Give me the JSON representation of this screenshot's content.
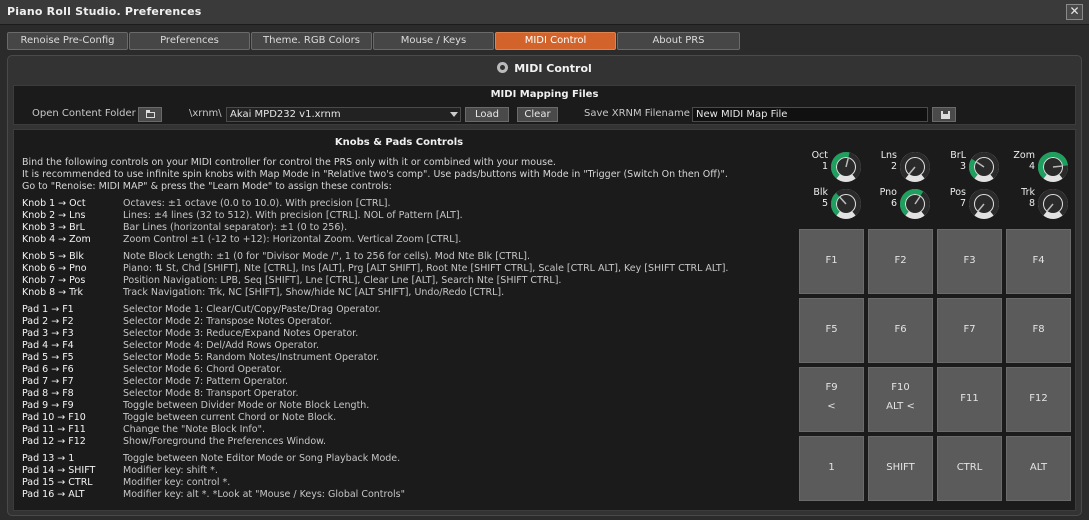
{
  "window": {
    "title": "Piano Roll Studio.  Preferences",
    "close_glyph": "✕"
  },
  "tabs": [
    {
      "label": "Renoise Pre-Config"
    },
    {
      "label": "Preferences"
    },
    {
      "label": "Theme. RGB Colors"
    },
    {
      "label": "Mouse / Keys"
    },
    {
      "label": "MIDI Control",
      "active": true
    },
    {
      "label": "About PRS"
    }
  ],
  "panel": {
    "title": "MIDI Control",
    "icon": "midi-icon"
  },
  "mapping": {
    "title": "MIDI Mapping Files",
    "open_folder_label": "Open Content Folder",
    "path_prefix": "\\xrnm\\",
    "selected_file": "Akai MPD232 v1.xrnm",
    "load_label": "Load",
    "clear_label": "Clear",
    "save_label": "Save XRNM Filename",
    "save_filename": "New MIDI Map File"
  },
  "knobs_pads": {
    "title": "Knobs & Pads Controls",
    "intro": [
      "Bind the following controls on your MIDI controller for control the PRS only with it or combined with your mouse.",
      "It is recommended to use infinite spin knobs with Map Mode in \"Relative two's comp\". Use pads/buttons with Mode in \"Trigger (Switch On then Off)\".",
      "Go to \"Renoise: MIDI MAP\" & press the \"Learn Mode\" to assign these controls:"
    ],
    "knob_rows": [
      {
        "key": "Knob 1 → Oct",
        "desc": "Octaves: ±1 octave (0.0 to 10.0). With precision [CTRL]."
      },
      {
        "key": "Knob 2 → Lns",
        "desc": "Lines: ±4 lines (32 to 512). With precision [CTRL]. NOL of Pattern [ALT]."
      },
      {
        "key": "Knob 3 → BrL",
        "desc": "Bar Lines (horizontal separator): ±1 (0 to 256)."
      },
      {
        "key": "Knob 4 → Zom",
        "desc": "Zoom Control ±1 (-12 to +12): Horizontal Zoom. Vertical Zoom [CTRL]."
      }
    ],
    "knob_rows2": [
      {
        "key": "Knob 5 → Blk",
        "desc": "Note Block Length: ±1 (0 for \"Divisor Mode /\", 1 to 256 for cells). Mod Nte Blk [CTRL]."
      },
      {
        "key": "Knob 6 → Pno",
        "desc": "Piano: ⇅ St, Chd [SHIFT], Nte [CTRL], Ins [ALT], Prg [ALT SHIFT], Root Nte [SHIFT CTRL], Scale [CTRL ALT], Key [SHIFT CTRL ALT]."
      },
      {
        "key": "Knob 7 → Pos",
        "desc": "Position Navigation: LPB, Seq [SHIFT], Lne [CTRL], Clear Lne [ALT], Search Nte [SHIFT CTRL]."
      },
      {
        "key": "Knob 8 → Trk",
        "desc": "Track Navigation: Trk, NC [SHIFT], Show/hide NC [ALT SHIFT], Undo/Redo [CTRL]."
      }
    ],
    "pad_rows": [
      {
        "key": "Pad 1 → F1",
        "desc": "Selector Mode 1: Clear/Cut/Copy/Paste/Drag Operator."
      },
      {
        "key": "Pad 2 → F2",
        "desc": "Selector Mode 2: Transpose Notes Operator."
      },
      {
        "key": "Pad 3 → F3",
        "desc": "Selector Mode 3: Reduce/Expand Notes Operator."
      },
      {
        "key": "Pad 4 → F4",
        "desc": "Selector Mode 4: Del/Add Rows Operator."
      },
      {
        "key": "Pad 5 → F5",
        "desc": "Selector Mode 5: Random Notes/Instrument Operator."
      },
      {
        "key": "Pad 6 → F6",
        "desc": "Selector Mode 6: Chord Operator."
      },
      {
        "key": "Pad 7 → F7",
        "desc": "Selector Mode 7: Pattern Operator."
      },
      {
        "key": "Pad 8 → F8",
        "desc": "Selector Mode 8: Transport Operator."
      },
      {
        "key": "Pad 9 → F9",
        "desc": "Toggle between Divider Mode or Note Block Length."
      },
      {
        "key": "Pad 10 → F10",
        "desc": "Toggle between current Chord or Note Block."
      },
      {
        "key": "Pad 11 → F11",
        "desc": "Change the \"Note Block Info\"."
      },
      {
        "key": "Pad 12 → F12",
        "desc": "Show/Foreground the Preferences Window."
      }
    ],
    "pad_rows2": [
      {
        "key": "Pad 13 → 1",
        "desc": "Toggle between Note Editor Mode or Song Playback Mode."
      },
      {
        "key": "Pad 14 → SHIFT",
        "desc": "Modifier key: shift *."
      },
      {
        "key": "Pad 15 → CTRL",
        "desc": "Modifier key: control *."
      },
      {
        "key": "Pad 16 → ALT",
        "desc": "Modifier key: alt *.            *Look at \"Mouse / Keys: Global Controls\""
      }
    ]
  },
  "knobs": [
    {
      "label": "Oct",
      "num": "1",
      "level": 0.55
    },
    {
      "label": "Lns",
      "num": "2",
      "level": 0.0
    },
    {
      "label": "BrL",
      "num": "3",
      "level": 0.3
    },
    {
      "label": "Zom",
      "num": "4",
      "level": 0.8
    },
    {
      "label": "Blk",
      "num": "5",
      "level": 0.35
    },
    {
      "label": "Pno",
      "num": "6",
      "level": 0.62
    },
    {
      "label": "Pos",
      "num": "7",
      "level": 0.0
    },
    {
      "label": "Trk",
      "num": "8",
      "level": 0.0
    }
  ],
  "pads": [
    {
      "label": "F1"
    },
    {
      "label": "F2"
    },
    {
      "label": "F3"
    },
    {
      "label": "F4"
    },
    {
      "label": "F5"
    },
    {
      "label": "F6"
    },
    {
      "label": "F7"
    },
    {
      "label": "F8"
    },
    {
      "label": "F9",
      "sub": "<"
    },
    {
      "label": "F10",
      "sub": "ALT <"
    },
    {
      "label": "F11"
    },
    {
      "label": "F12"
    },
    {
      "label": "1"
    },
    {
      "label": "SHIFT"
    },
    {
      "label": "CTRL"
    },
    {
      "label": "ALT"
    }
  ],
  "colors": {
    "accent": "#d2632a",
    "knob_green": "#1fa05f",
    "knob_track": "#2a2a2a"
  }
}
